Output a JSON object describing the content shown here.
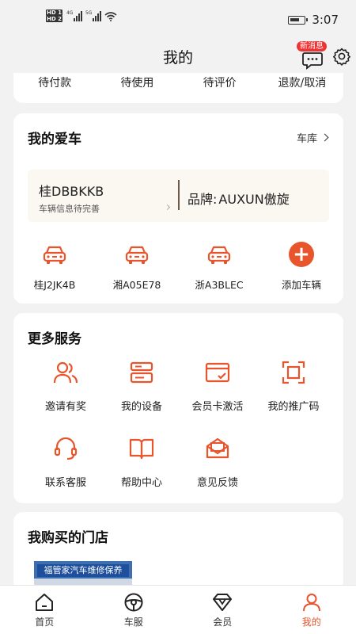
{
  "status": {
    "time": "3:07",
    "sim": [
      "HD 1",
      "HD 2"
    ],
    "net": [
      "4G",
      "5G"
    ]
  },
  "header": {
    "title": "我的",
    "msg_badge": "新消息"
  },
  "orders": {
    "tabs": [
      "待付款",
      "待使用",
      "待评价",
      "退款/取消"
    ]
  },
  "my_car": {
    "title": "我的爱车",
    "garage_label": "车库",
    "current": {
      "plate": "桂DBBKKB",
      "status": "车辆信息待完善",
      "brand_label": "品牌:",
      "brand_value": "AUXUN傲旋"
    },
    "cars": [
      "桂J2JK4B",
      "湘A05E78",
      "浙A3BLEC"
    ],
    "add_label": "添加车辆"
  },
  "services": {
    "title": "更多服务",
    "items": [
      "邀请有奖",
      "我的设备",
      "会员卡激活",
      "我的推广码",
      "联系客服",
      "帮助中心",
      "意见反馈"
    ]
  },
  "stores": {
    "title": "我购买的门店",
    "thumb_sign": "福管家汽车维修保养"
  },
  "tabbar": {
    "items": [
      "首页",
      "车服",
      "会员",
      "我的"
    ],
    "active_index": 3
  },
  "colors": {
    "accent": "#e8542c",
    "card_bg": "#ffffff",
    "page_bg": "#f2f2f2",
    "badge": "#e33333"
  }
}
